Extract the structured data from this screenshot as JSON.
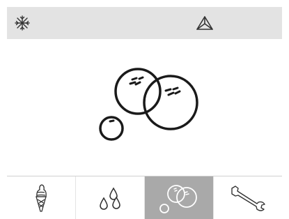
{
  "status_bar": {
    "left_icon": "snowflake-icon",
    "right_icon": "triangle-cleaning-icon"
  },
  "main_display": {
    "icon": "bubbles-icon"
  },
  "tabs": [
    {
      "icon": "ice-cream-cone-icon",
      "active": false
    },
    {
      "icon": "water-drops-icon",
      "active": false
    },
    {
      "icon": "bubbles-icon",
      "active": true
    },
    {
      "icon": "wrench-icon",
      "active": false
    }
  ],
  "colors": {
    "status_bar_bg": "#e3e3e3",
    "active_tab_bg": "#a9a9a9",
    "icon_stroke": "#1a1a1a",
    "active_icon": "#ffffff"
  }
}
